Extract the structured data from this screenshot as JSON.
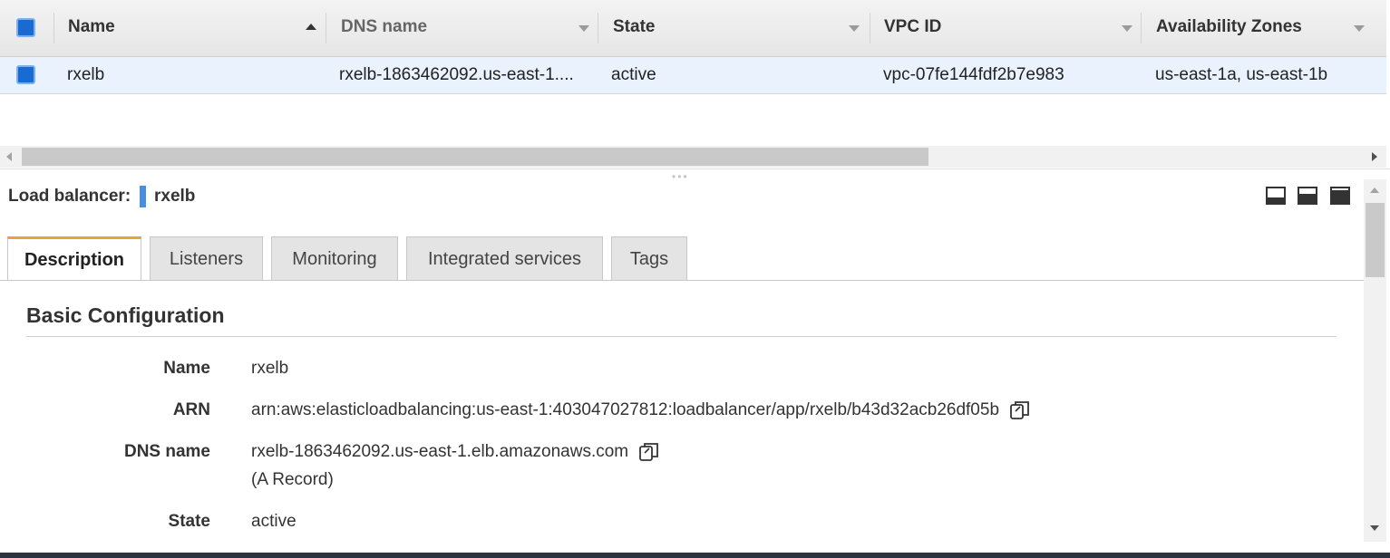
{
  "table": {
    "columns": [
      {
        "label": "Name",
        "sort": "ascending"
      },
      {
        "label": "DNS name",
        "sort": "none"
      },
      {
        "label": "State",
        "sort": "none"
      },
      {
        "label": "VPC ID",
        "sort": "none"
      },
      {
        "label": "Availability Zones",
        "sort": "none"
      }
    ],
    "rows": [
      {
        "selected": true,
        "name": "rxelb",
        "dns_name": "rxelb-1863462092.us-east-1....",
        "state": "active",
        "vpc_id": "vpc-07fe144fdf2b7e983",
        "availability_zones": "us-east-1a, us-east-1b"
      }
    ]
  },
  "details": {
    "title_label": "Load balancer:",
    "title_value": "rxelb",
    "tabs": [
      {
        "label": "Description",
        "active": true
      },
      {
        "label": "Listeners",
        "active": false
      },
      {
        "label": "Monitoring",
        "active": false
      },
      {
        "label": "Integrated services",
        "active": false
      },
      {
        "label": "Tags",
        "active": false
      }
    ],
    "section_title": "Basic Configuration",
    "fields": [
      {
        "label": "Name",
        "value": "rxelb"
      },
      {
        "label": "ARN",
        "value": "arn:aws:elasticloadbalancing:us-east-1:403047027812:loadbalancer/app/rxelb/b43d32acb26df05b"
      },
      {
        "label": "DNS name",
        "value": "rxelb-1863462092.us-east-1.elb.amazonaws.com",
        "value_note": "(A Record)"
      },
      {
        "label": "State",
        "value": "active"
      }
    ]
  },
  "colors": {
    "accent_tab": "#e8a33d",
    "checkbox": "#1a6bd1",
    "selected_row": "#eaf2fd",
    "title_marker": "#4a90d9"
  },
  "icons": [
    "sort-ascending-icon",
    "sort-dropdown-icon",
    "copy-icon",
    "pane-layout-icon"
  ]
}
